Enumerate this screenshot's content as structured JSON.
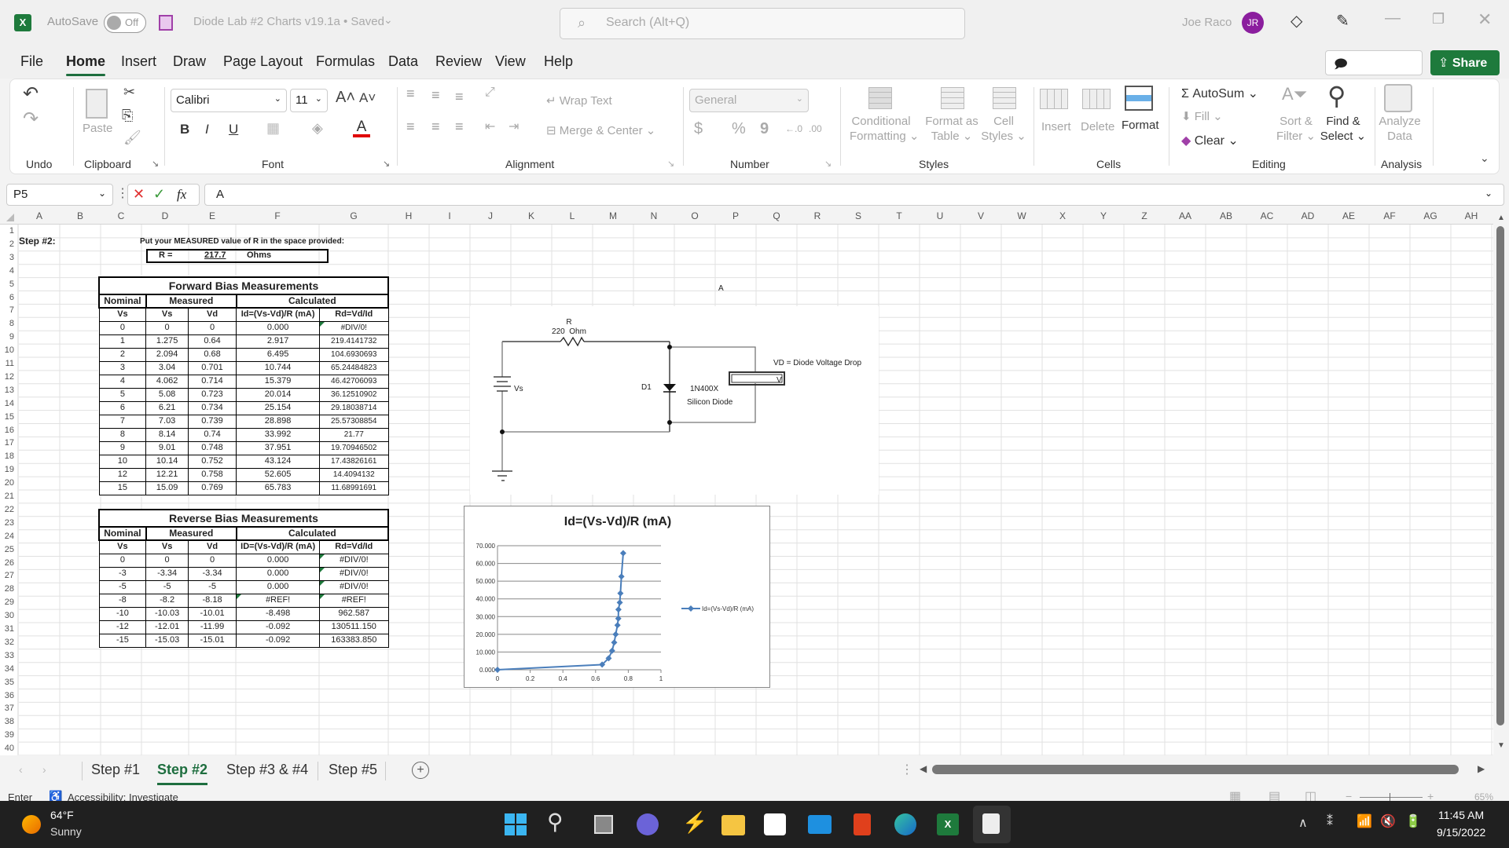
{
  "titlebar": {
    "autosave_label": "AutoSave",
    "autosave_state": "Off",
    "doc_title": "Diode Lab #2 Charts v19.1a • Saved",
    "search_placeholder": "Search (Alt+Q)",
    "user_name": "Joe Raco",
    "user_initials": "JR",
    "avatar_color": "#8b1e9e"
  },
  "menu": {
    "tabs": [
      "File",
      "Home",
      "Insert",
      "Draw",
      "Page Layout",
      "Formulas",
      "Data",
      "Review",
      "View",
      "Help"
    ],
    "active": "Home",
    "comments_label": "Comments",
    "share_label": "Share",
    "share_color": "#1e7a3c"
  },
  "ribbon": {
    "undo_group": "Undo",
    "clipboard": {
      "label": "Clipboard",
      "paste": "Paste"
    },
    "font": {
      "label": "Font",
      "name": "Calibri",
      "size": "11",
      "bold": "B",
      "italic": "I",
      "underline": "U"
    },
    "alignment": {
      "label": "Alignment",
      "wrap_text": "Wrap Text",
      "merge_center": "Merge & Center"
    },
    "number": {
      "label": "Number",
      "format": "General",
      "currency": "$",
      "percent": "%",
      "comma": "9"
    },
    "styles": {
      "label": "Styles",
      "conditional": [
        "Conditional",
        "Formatting"
      ],
      "format_table": [
        "Format as",
        "Table"
      ],
      "cell_styles": [
        "Cell",
        "Styles"
      ]
    },
    "cells": {
      "label": "Cells",
      "insert": "Insert",
      "delete": "Delete",
      "format": "Format"
    },
    "editing": {
      "label": "Editing",
      "autosum": "AutoSum",
      "fill": "Fill",
      "clear": "Clear",
      "sort_filter": [
        "Sort &",
        "Filter"
      ],
      "find_select": [
        "Find &",
        "Select"
      ]
    },
    "analysis": {
      "label": "Analysis",
      "analyze_data": [
        "Analyze",
        "Data"
      ]
    }
  },
  "formula_bar": {
    "name_box": "P5",
    "fx": "fx",
    "content": "A"
  },
  "columns": [
    "A",
    "B",
    "C",
    "D",
    "E",
    "F",
    "G",
    "H",
    "I",
    "J",
    "K",
    "L",
    "M",
    "N",
    "O",
    "P",
    "Q",
    "R",
    "S",
    "T",
    "U",
    "V",
    "W",
    "X",
    "Y",
    "Z",
    "AA",
    "AB",
    "AC",
    "AD",
    "AE",
    "AF",
    "AG",
    "AH"
  ],
  "rows": [
    "1",
    "2",
    "3",
    "4",
    "5",
    "6",
    "7",
    "8",
    "9",
    "10",
    "11",
    "12",
    "13",
    "14",
    "15",
    "16",
    "17",
    "18",
    "19",
    "20",
    "21",
    "22",
    "23",
    "24",
    "25",
    "26",
    "27",
    "28",
    "29",
    "30",
    "31",
    "32",
    "33",
    "34",
    "35",
    "36",
    "37",
    "38",
    "39",
    "40"
  ],
  "sheet": {
    "step_label": "Step #2:",
    "instruction": "Put your MEASURED value of R in the space provided:",
    "r_label": "R  =",
    "r_value": "217.7",
    "r_unit": "Ohms",
    "p5_text": "A",
    "forward": {
      "title": "Forward Bias Measurements",
      "groups": [
        "Nominal",
        "Measured",
        "Calculated"
      ],
      "headers": [
        "Vs",
        "Vs",
        "Vd",
        "Id=(Vs-Vd)/R (mA)",
        "Rd=Vd/Id"
      ],
      "rows": [
        [
          "0",
          "0",
          "0",
          "0.000",
          "#DIV/0!"
        ],
        [
          "1",
          "1.275",
          "0.64",
          "2.917",
          "219.4141732"
        ],
        [
          "2",
          "2.094",
          "0.68",
          "6.495",
          "104.6930693"
        ],
        [
          "3",
          "3.04",
          "0.701",
          "10.744",
          "65.24484823"
        ],
        [
          "4",
          "4.062",
          "0.714",
          "15.379",
          "46.42706093"
        ],
        [
          "5",
          "5.08",
          "0.723",
          "20.014",
          "36.12510902"
        ],
        [
          "6",
          "6.21",
          "0.734",
          "25.154",
          "29.18038714"
        ],
        [
          "7",
          "7.03",
          "0.739",
          "28.898",
          "25.57308854"
        ],
        [
          "8",
          "8.14",
          "0.74",
          "33.992",
          "21.77"
        ],
        [
          "9",
          "9.01",
          "0.748",
          "37.951",
          "19.70946502"
        ],
        [
          "10",
          "10.14",
          "0.752",
          "43.124",
          "17.43826161"
        ],
        [
          "12",
          "12.21",
          "0.758",
          "52.605",
          "14.4094132"
        ],
        [
          "15",
          "15.09",
          "0.769",
          "65.783",
          "11.68991691"
        ]
      ]
    },
    "reverse": {
      "title": "Reverse Bias Measurements",
      "groups": [
        "Nominal",
        "Measured",
        "Calculated"
      ],
      "headers": [
        "Vs",
        "Vs",
        "Vd",
        "ID=(Vs-Vd)/R (mA)",
        "Rd=Vd/Id"
      ],
      "rows": [
        [
          "0",
          "0",
          "0",
          "0.000",
          "#DIV/0!"
        ],
        [
          "-3",
          "-3.34",
          "-3.34",
          "0.000",
          "#DIV/0!"
        ],
        [
          "-5",
          "-5",
          "-5",
          "0.000",
          "#DIV/0!"
        ],
        [
          "-8",
          "-8.2",
          "-8.18",
          "#REF!",
          "#REF!"
        ],
        [
          "-10",
          "-10.03",
          "-10.01",
          "-8.498",
          "962.587"
        ],
        [
          "-12",
          "-12.01",
          "-11.99",
          "-0.092",
          "130511.150"
        ],
        [
          "-15",
          "-15.03",
          "-15.01",
          "-0.092",
          "163383.850"
        ]
      ]
    }
  },
  "circuit": {
    "resistor_name": "R",
    "resistor_value": "220  Ohm",
    "source_label": "Vs",
    "diode_name": "D1",
    "diode_part": "1N400X",
    "diode_type": "Silicon Diode",
    "meter_label": "V",
    "meter_note": "VD = Diode Voltage Drop"
  },
  "chart_data": {
    "type": "scatter",
    "title": "Id=(Vs-Vd)/R (mA)",
    "xlabel": "",
    "ylabel": "",
    "x": [
      0,
      0.64,
      0.68,
      0.701,
      0.714,
      0.723,
      0.734,
      0.739,
      0.74,
      0.748,
      0.752,
      0.758,
      0.769
    ],
    "series": [
      {
        "name": "Id=(Vs-Vd)/R (mA)",
        "values": [
          0,
          2.917,
          6.495,
          10.744,
          15.379,
          20.014,
          25.154,
          28.898,
          33.992,
          37.951,
          43.124,
          52.605,
          65.783
        ],
        "color": "#4a7ebb"
      }
    ],
    "xlim": [
      0,
      1
    ],
    "ylim": [
      0,
      70
    ],
    "xticks": [
      "0",
      "0.2",
      "0.4",
      "0.6",
      "0.8",
      "1"
    ],
    "yticks": [
      "0.000",
      "10.000",
      "20.000",
      "30.000",
      "40.000",
      "50.000",
      "60.000",
      "70.000"
    ],
    "grid": true,
    "legend": "right",
    "lines_with_markers": true
  },
  "sheet_tabs": {
    "tabs": [
      "Step #1",
      "Step #2",
      "Step #3 & #4",
      "Step #5"
    ],
    "active": "Step #2"
  },
  "status": {
    "mode": "Enter",
    "accessibility": "Accessibility: Investigate",
    "zoom": "65%"
  },
  "taskbar": {
    "temp": "64°F",
    "weather": "Sunny",
    "time": "11:45 AM",
    "date": "9/15/2022",
    "apps": [
      "start",
      "search",
      "task-view",
      "teams",
      "app-launcher",
      "file-explorer",
      "store",
      "mail",
      "office",
      "edge",
      "excel",
      "snipping-tool"
    ]
  }
}
